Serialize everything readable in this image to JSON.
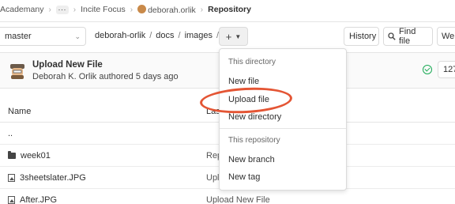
{
  "breadcrumb": {
    "group": "Academany",
    "more": "···",
    "project": "Incite Focus",
    "user": "deborah.orlik",
    "current": "Repository"
  },
  "toolbar": {
    "branch": "master",
    "path": [
      "deborah-orlik",
      "docs",
      "images"
    ],
    "plus": "+",
    "history": "History",
    "find_file": "Find file",
    "web_ide": "Web"
  },
  "commit": {
    "title": "Upload New File",
    "meta": "Deborah K. Orlik authored 5 days ago",
    "sha": "127"
  },
  "table": {
    "col_name": "Name",
    "col_last": "Las",
    "rows": [
      {
        "name": "..",
        "message": "",
        "icon": "none"
      },
      {
        "name": "week01",
        "message": "Rep",
        "icon": "folder-icon"
      },
      {
        "name": "3sheetslater.JPG",
        "message": "Uplo",
        "icon": "image-icon"
      },
      {
        "name": "After.JPG",
        "message": "Upload New File",
        "icon": "image-icon"
      }
    ]
  },
  "dropdown": {
    "header_dir": "This directory",
    "new_file": "New file",
    "upload_file": "Upload file",
    "new_directory": "New directory",
    "header_repo": "This repository",
    "new_branch": "New branch",
    "new_tag": "New tag"
  },
  "colors": {
    "annotation": "#e45534",
    "pipeline_success": "#1aaa55"
  }
}
